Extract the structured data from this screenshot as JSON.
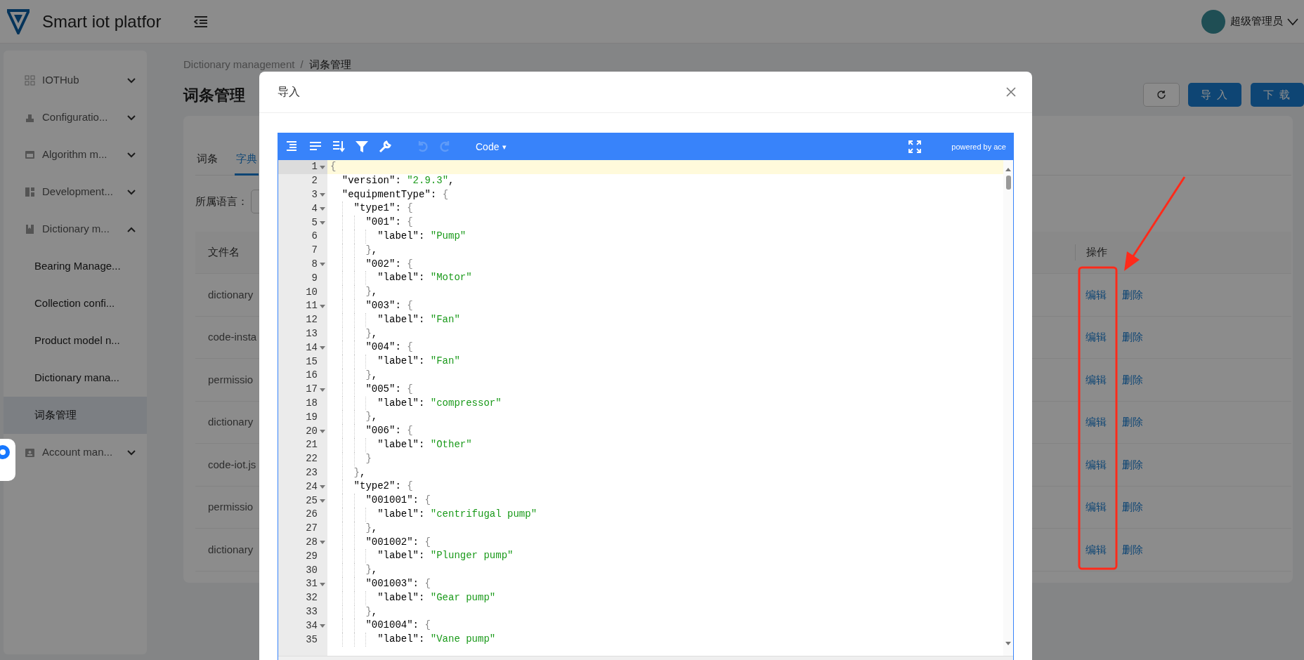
{
  "header": {
    "title": "Smart iot platfor",
    "user": "超级管理员"
  },
  "sidebar": {
    "items": [
      {
        "label": "IOTHub",
        "expanded": false
      },
      {
        "label": "Configuratio...",
        "expanded": false
      },
      {
        "label": "Algorithm m...",
        "expanded": false
      },
      {
        "label": "Development...",
        "expanded": false
      },
      {
        "label": "Dictionary m...",
        "expanded": true,
        "children": [
          {
            "label": "Bearing Manage...",
            "selected": false
          },
          {
            "label": "Collection confi...",
            "selected": false
          },
          {
            "label": "Product model n...",
            "selected": false
          },
          {
            "label": "Dictionary mana...",
            "selected": false
          },
          {
            "label": "词条管理",
            "selected": true
          }
        ]
      },
      {
        "label": "Account man...",
        "expanded": false
      }
    ]
  },
  "breadcrumb": {
    "items": [
      "Dictionary management",
      "词条管理"
    ],
    "separator": "/"
  },
  "page_title": "词条管理",
  "buttons": [
    "导 入",
    "下 载"
  ],
  "tabs": [
    {
      "label": "词条",
      "selected": false
    },
    {
      "label": "字典",
      "selected": true
    }
  ],
  "filter": {
    "label": "所属语言："
  },
  "table": {
    "columns": [
      "文件名",
      "操作"
    ],
    "rows": [
      {
        "file": "dictionary",
        "actions": [
          "编辑",
          "删除"
        ]
      },
      {
        "file": "code-insta",
        "actions": [
          "编辑",
          "删除"
        ]
      },
      {
        "file": "permissio",
        "actions": [
          "编辑",
          "删除"
        ]
      },
      {
        "file": "dictionary",
        "actions": [
          "编辑",
          "删除"
        ]
      },
      {
        "file": "code-iot.js",
        "actions": [
          "编辑",
          "删除"
        ]
      },
      {
        "file": "permissio",
        "actions": [
          "编辑",
          "删除"
        ]
      },
      {
        "file": "dictionary",
        "actions": [
          "编辑",
          "删除"
        ]
      }
    ]
  },
  "modal": {
    "title": "导入",
    "editor": {
      "mode": "Code",
      "mode_caret": "▾",
      "brand": "powered by ace",
      "undo_disabled": true,
      "redo_disabled": true,
      "lines": [
        {
          "n": "1",
          "text": "{",
          "fold": true,
          "active": true
        },
        {
          "n": "2",
          "text": "  \"version\": \"2.9.3\",",
          "fold": false,
          "active": false
        },
        {
          "n": "3",
          "text": "  \"equipmentType\": {",
          "fold": true,
          "active": false
        },
        {
          "n": "4",
          "text": "    \"type1\": {",
          "fold": true,
          "active": false
        },
        {
          "n": "5",
          "text": "      \"001\": {",
          "fold": true,
          "active": false
        },
        {
          "n": "6",
          "text": "        \"label\": \"Pump\"",
          "fold": false,
          "active": false
        },
        {
          "n": "7",
          "text": "      },",
          "fold": false,
          "active": false
        },
        {
          "n": "8",
          "text": "      \"002\": {",
          "fold": true,
          "active": false
        },
        {
          "n": "9",
          "text": "        \"label\": \"Motor\"",
          "fold": false,
          "active": false
        },
        {
          "n": "10",
          "text": "      },",
          "fold": false,
          "active": false
        },
        {
          "n": "11",
          "text": "      \"003\": {",
          "fold": true,
          "active": false
        },
        {
          "n": "12",
          "text": "        \"label\": \"Fan\"",
          "fold": false,
          "active": false
        },
        {
          "n": "13",
          "text": "      },",
          "fold": false,
          "active": false
        },
        {
          "n": "14",
          "text": "      \"004\": {",
          "fold": true,
          "active": false
        },
        {
          "n": "15",
          "text": "        \"label\": \"Fan\"",
          "fold": false,
          "active": false
        },
        {
          "n": "16",
          "text": "      },",
          "fold": false,
          "active": false
        },
        {
          "n": "17",
          "text": "      \"005\": {",
          "fold": true,
          "active": false
        },
        {
          "n": "18",
          "text": "        \"label\": \"compressor\"",
          "fold": false,
          "active": false
        },
        {
          "n": "19",
          "text": "      },",
          "fold": false,
          "active": false
        },
        {
          "n": "20",
          "text": "      \"006\": {",
          "fold": true,
          "active": false
        },
        {
          "n": "21",
          "text": "        \"label\": \"Other\"",
          "fold": false,
          "active": false
        },
        {
          "n": "22",
          "text": "      }",
          "fold": false,
          "active": false
        },
        {
          "n": "23",
          "text": "    },",
          "fold": false,
          "active": false
        },
        {
          "n": "24",
          "text": "    \"type2\": {",
          "fold": true,
          "active": false
        },
        {
          "n": "25",
          "text": "      \"001001\": {",
          "fold": true,
          "active": false
        },
        {
          "n": "26",
          "text": "        \"label\": \"centrifugal pump\"",
          "fold": false,
          "active": false
        },
        {
          "n": "27",
          "text": "      },",
          "fold": false,
          "active": false
        },
        {
          "n": "28",
          "text": "      \"001002\": {",
          "fold": true,
          "active": false
        },
        {
          "n": "29",
          "text": "        \"label\": \"Plunger pump\"",
          "fold": false,
          "active": false
        },
        {
          "n": "30",
          "text": "      },",
          "fold": false,
          "active": false
        },
        {
          "n": "31",
          "text": "      \"001003\": {",
          "fold": true,
          "active": false
        },
        {
          "n": "32",
          "text": "        \"label\": \"Gear pump\"",
          "fold": false,
          "active": false
        },
        {
          "n": "33",
          "text": "      },",
          "fold": false,
          "active": false
        },
        {
          "n": "34",
          "text": "      \"001004\": {",
          "fold": true,
          "active": false
        },
        {
          "n": "35",
          "text": "        \"label\": \"Vane pump\"",
          "fold": false,
          "active": false
        }
      ]
    }
  },
  "annotation": {
    "box": true,
    "arrow": true
  }
}
